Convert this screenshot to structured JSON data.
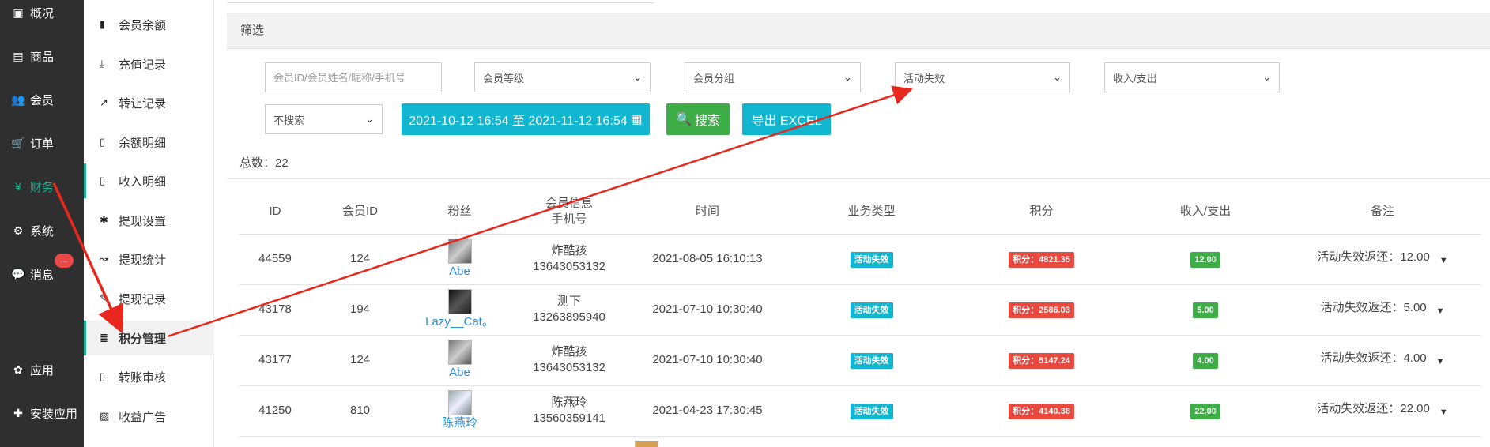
{
  "nav": {
    "items": [
      {
        "label": "概况",
        "icon": "dashboard-icon"
      },
      {
        "label": "商品",
        "icon": "goods-icon"
      },
      {
        "label": "会员",
        "icon": "users-icon"
      },
      {
        "label": "订单",
        "icon": "cart-icon"
      },
      {
        "label": "财务",
        "icon": "yen-icon",
        "active": true
      },
      {
        "label": "系统",
        "icon": "gears-icon"
      },
      {
        "label": "消息",
        "icon": "message-icon"
      },
      {
        "label": "应用",
        "icon": "apps-icon"
      },
      {
        "label": "安装应用",
        "icon": "puzzle-icon"
      }
    ],
    "message_badge": "...",
    "active_color": "#19b394"
  },
  "submenu": {
    "items": [
      {
        "label": "会员余额",
        "icon": "book-icon"
      },
      {
        "label": "充值记录",
        "icon": "download-icon"
      },
      {
        "label": "转让记录",
        "icon": "external-link-icon"
      },
      {
        "label": "余额明细",
        "icon": "file-icon"
      },
      {
        "label": "收入明细",
        "icon": "file-icon"
      },
      {
        "label": "提现设置",
        "icon": "gear-icon"
      },
      {
        "label": "提现统计",
        "icon": "line-chart-icon"
      },
      {
        "label": "提现记录",
        "icon": "pencil-icon"
      },
      {
        "label": "积分管理",
        "icon": "database-icon",
        "active": true
      },
      {
        "label": "转账审核",
        "icon": "file-icon"
      },
      {
        "label": "收益广告",
        "icon": "image-icon"
      }
    ]
  },
  "filter": {
    "title": "筛选",
    "search_placeholder": "会员ID/会员姓名/昵称/手机号",
    "level_select": "会员等级",
    "group_select": "会员分组",
    "type_select": "活动失效",
    "io_select": "收入/支出",
    "search_mode_select": "不搜索",
    "date_range": "2021-10-12 16:54 至 2021-11-12 16:54",
    "search_button": "搜索",
    "export_button": "导出 EXCEL"
  },
  "summary": {
    "total_label": "总数：22"
  },
  "table": {
    "headers": {
      "id": "ID",
      "member_id": "会员ID",
      "fans": "粉丝",
      "member_info": "会员信息",
      "phone": "手机号",
      "time": "时间",
      "biz_type": "业务类型",
      "points": "积分",
      "io": "收入/支出",
      "note": "备注"
    },
    "rows": [
      {
        "id": "44559",
        "member_id": "124",
        "fan": "Abe",
        "name": "炸酷孩",
        "phone": "13643053132",
        "time": "2021-08-05 16:10:13",
        "type": "活动失效",
        "points": "积分：4821.35",
        "amount": "12.00",
        "note": "活动失效返还：12.00"
      },
      {
        "id": "43178",
        "member_id": "194",
        "fan": "Lazy__Cat。",
        "name": "测下",
        "phone": "13263895940",
        "time": "2021-07-10 10:30:40",
        "type": "活动失效",
        "points": "积分：2586.03",
        "amount": "5.00",
        "note": "活动失效返还：5.00"
      },
      {
        "id": "43177",
        "member_id": "124",
        "fan": "Abe",
        "name": "炸酷孩",
        "phone": "13643053132",
        "time": "2021-07-10 10:30:40",
        "type": "活动失效",
        "points": "积分：5147.24",
        "amount": "4.00",
        "note": "活动失效返还：4.00"
      },
      {
        "id": "41250",
        "member_id": "810",
        "fan": "陈燕玲",
        "name": "陈燕玲",
        "phone": "13560359141",
        "time": "2021-04-23 17:30:45",
        "type": "活动失效",
        "points": "积分：4140.38",
        "amount": "22.00",
        "note": "活动失效返还：22.00"
      }
    ]
  },
  "colors": {
    "sidebar_bg": "#2f2f2f",
    "accent_green": "#19b394",
    "tag_cyan": "#11b6d0",
    "tag_red": "#e84a3f",
    "tag_green": "#3fad47",
    "annotation_arrow": "#e8281e"
  }
}
